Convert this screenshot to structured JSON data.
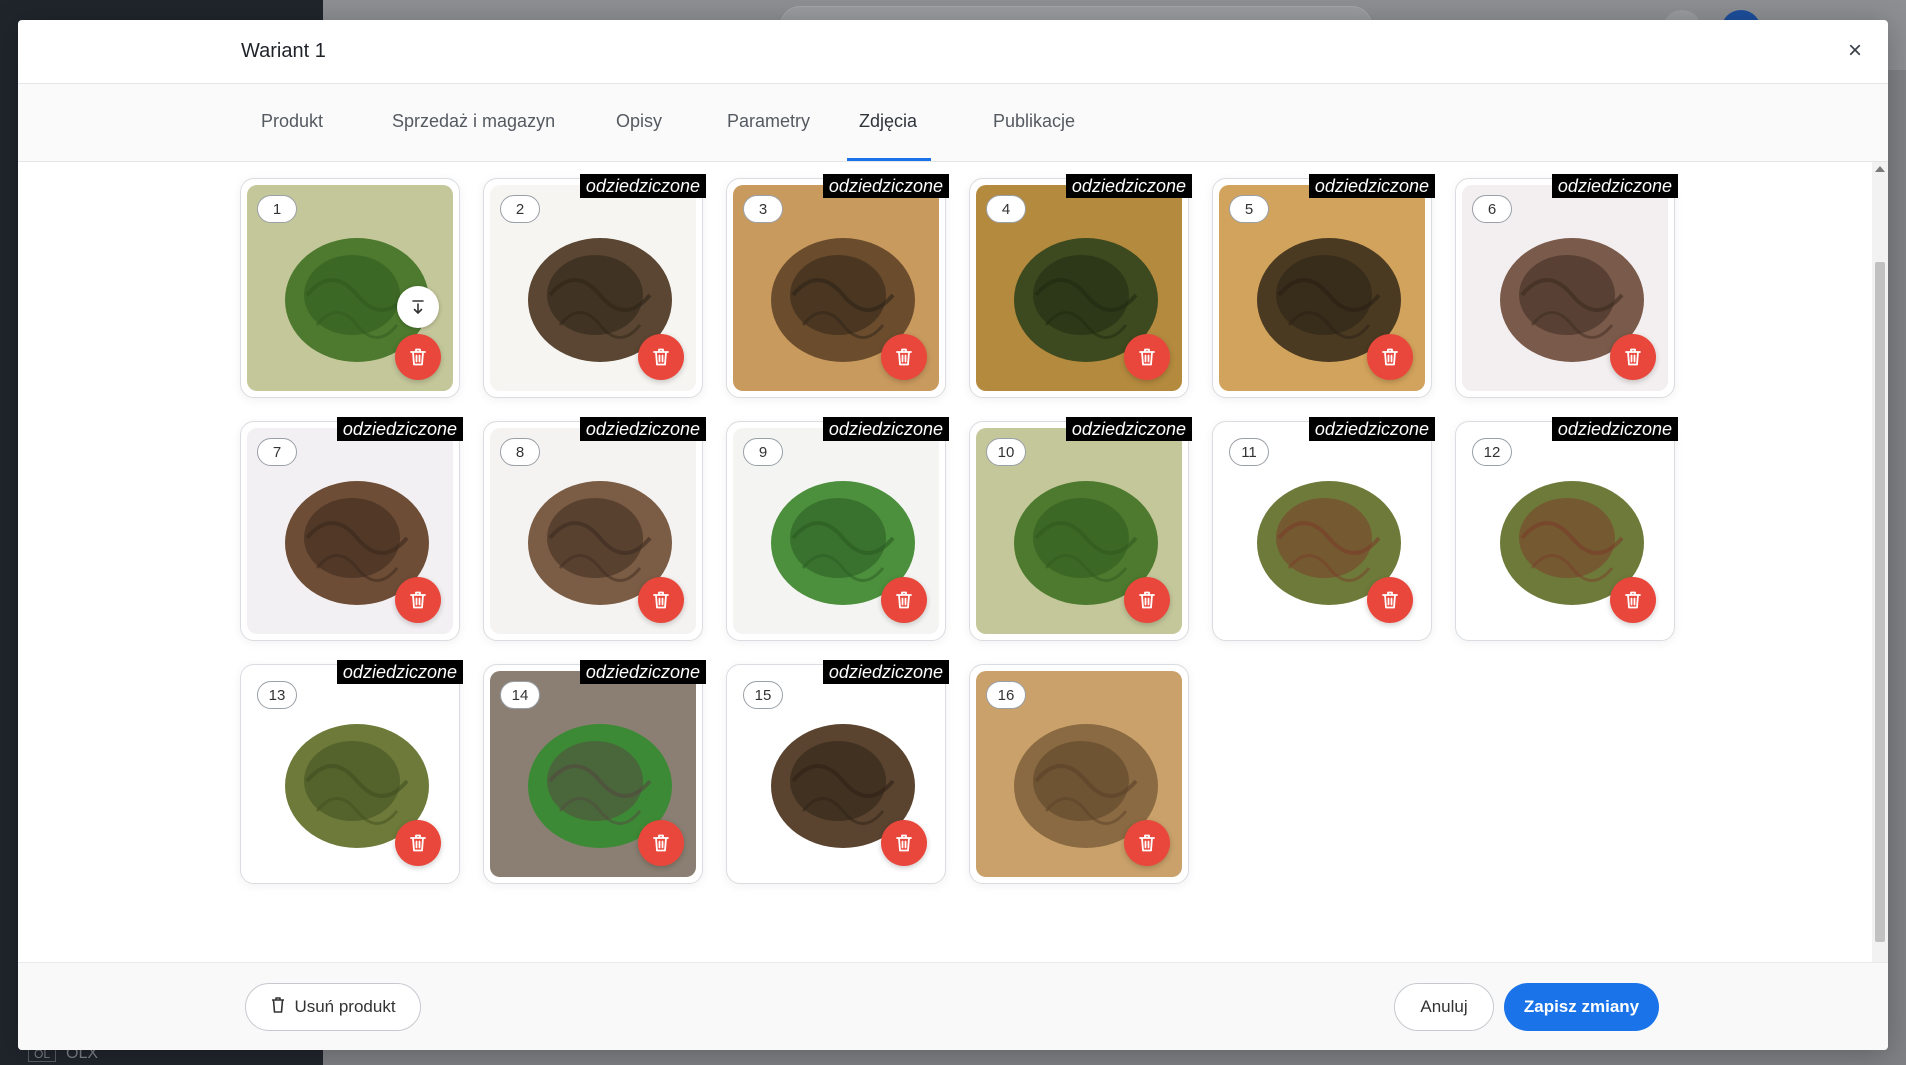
{
  "modal": {
    "title": "Wariant 1",
    "close_label": "×"
  },
  "tabs": [
    {
      "label": "Produkt"
    },
    {
      "label": "Sprzedaż i magazyn"
    },
    {
      "label": "Opisy"
    },
    {
      "label": "Parametry"
    },
    {
      "label": "Zdjęcia",
      "active": true
    },
    {
      "label": "Publikacje"
    }
  ],
  "gallery": {
    "inherited_label": "odziedziczone",
    "images": [
      {
        "number": "1",
        "inherited": false,
        "subject": "green-plant-on-olive-background"
      },
      {
        "number": "2",
        "inherited": true,
        "subject": "dry-rose-of-jericho"
      },
      {
        "number": "3",
        "inherited": true,
        "subject": "dry-plant-on-wooden-tray"
      },
      {
        "number": "4",
        "inherited": true,
        "subject": "plant-on-gold-tray"
      },
      {
        "number": "5",
        "inherited": true,
        "subject": "watering-plant-on-tray"
      },
      {
        "number": "6",
        "inherited": true,
        "subject": "dry-plant-ball"
      },
      {
        "number": "7",
        "inherited": true,
        "subject": "two-dry-balls"
      },
      {
        "number": "8",
        "inherited": true,
        "subject": "two-dry-balls-closeup"
      },
      {
        "number": "9",
        "inherited": true,
        "subject": "green-plant-in-glass-dish"
      },
      {
        "number": "10",
        "inherited": true,
        "subject": "green-plant-on-olive-background"
      },
      {
        "number": "11",
        "inherited": true,
        "subject": "greenish-brown-plant"
      },
      {
        "number": "12",
        "inherited": true,
        "subject": "greenish-brown-plant"
      },
      {
        "number": "13",
        "inherited": true,
        "subject": "green-plant-from-above"
      },
      {
        "number": "14",
        "inherited": true,
        "subject": "plant-on-rocks"
      },
      {
        "number": "15",
        "inherited": true,
        "subject": "two-dry-plants"
      },
      {
        "number": "16",
        "inherited": false,
        "subject": "dry-plant-on-sand"
      }
    ]
  },
  "footer": {
    "remove_label": "Usuń produkt",
    "cancel_label": "Anuluj",
    "save_label": "Zapisz zmiany"
  },
  "background": {
    "channel_tag": "OL",
    "channel_name": "OLX"
  },
  "colors": {
    "primary": "#1a73e8",
    "danger": "#e9473b",
    "inherited_badge": "#000000"
  },
  "icons": {
    "delete": "trash-icon",
    "download": "download-icon",
    "close": "close-icon"
  }
}
